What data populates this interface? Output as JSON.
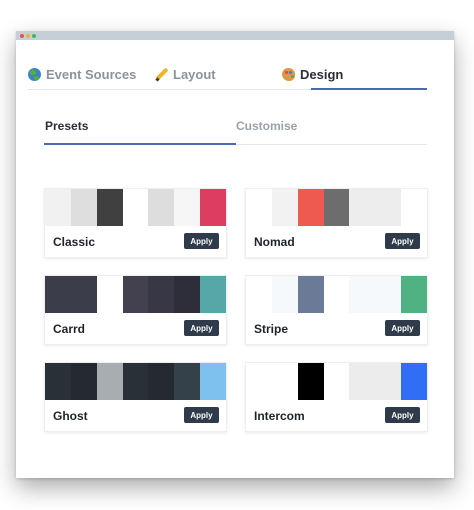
{
  "tabs": [
    {
      "label": "Event Sources",
      "icon": "globe-icon"
    },
    {
      "label": "Layout",
      "icon": "pencil-icon"
    },
    {
      "label": "Design",
      "icon": "palette-icon",
      "active": true
    }
  ],
  "subtabs": [
    {
      "label": "Presets",
      "active": true
    },
    {
      "label": "Customise"
    }
  ],
  "apply_label": "Apply",
  "presets": [
    {
      "name": "Classic",
      "colors": [
        "#f1f1f1",
        "#dedede",
        "#404040",
        "#ffffff",
        "#dddddd",
        "#f6f6f6",
        "#dc3e62"
      ]
    },
    {
      "name": "Nomad",
      "colors": [
        "#ffffff",
        "#f2f2f2",
        "#ee5a4f",
        "#6d6d6d",
        "#ededed",
        "#ededed",
        "#ffffff"
      ]
    },
    {
      "name": "Carrd",
      "colors": [
        "#3c3d4a",
        "#3c3d4a",
        "#ffffff",
        "#43414f",
        "#383745",
        "#2e2d3a",
        "#56a8a8"
      ]
    },
    {
      "name": "Stripe",
      "colors": [
        "#ffffff",
        "#f6f9fc",
        "#6b7a97",
        "#ffffff",
        "#f6f9fc",
        "#f6f9fc",
        "#50b282"
      ]
    },
    {
      "name": "Ghost",
      "colors": [
        "#2a3038",
        "#252a30",
        "#a8adb2",
        "#2a3038",
        "#252a30",
        "#35414a",
        "#7ec0ee"
      ]
    },
    {
      "name": "Intercom",
      "colors": [
        "#ffffff",
        "#ffffff",
        "#000000",
        "#ffffff",
        "#ececec",
        "#ececec",
        "#2f6ef5"
      ]
    }
  ]
}
